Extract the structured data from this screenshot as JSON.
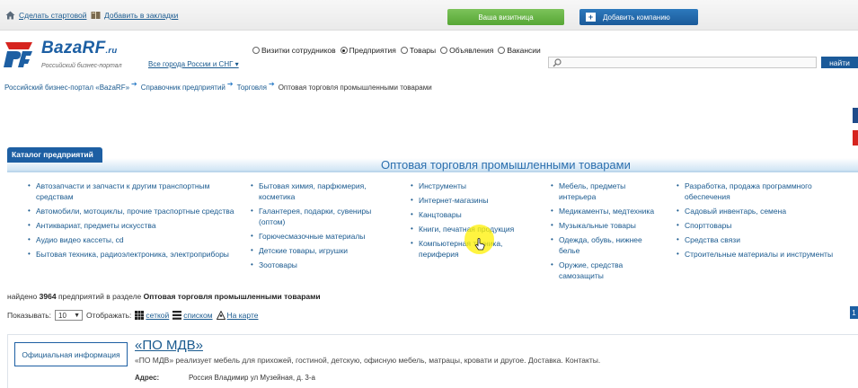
{
  "topbar": {
    "make_start": "Сделать стартовой",
    "bookmark": "Добавить в закладки",
    "card_button": "Ваша визитница",
    "add_button": "Добавить компанию",
    "plus_symbol": "+"
  },
  "logo": {
    "name": "BazaRF",
    "suffix": ".ru",
    "tagline": "Российский бизнес-портал"
  },
  "region": "Все города России и СНГ ▾",
  "search_types": [
    {
      "label": "Визитки сотрудников",
      "checked": false
    },
    {
      "label": "Предприятия",
      "checked": true
    },
    {
      "label": "Товары",
      "checked": false
    },
    {
      "label": "Объявления",
      "checked": false
    },
    {
      "label": "Вакансии",
      "checked": false
    }
  ],
  "search": {
    "value": "",
    "button": "найти"
  },
  "breadcrumb": {
    "items": [
      "Российский бизнес-портал «BazaRF»",
      "Справочник предприятий",
      "Торговля"
    ],
    "current": "Оптовая торговля промышленными товарами"
  },
  "catalog": {
    "tab": "Каталог предприятий",
    "title": "Оптовая торговля промышленными товарами",
    "col1": [
      "Автозапчасти и запчасти к другим транспортным средствам",
      "Автомобили, мотоциклы, прочие траспортные средства",
      "Антиквариат, предметы искусства",
      "Аудио видео кассеты, cd",
      "Бытовая техника, радиоэлектроника, электроприборы"
    ],
    "col2": [
      "Бытовая химия, парфюмерия, косметика",
      "Галантерея, подарки, сувениры (оптом)",
      "Горючесмазочные материалы",
      "Детские товары, игрушки",
      "Зоотовары"
    ],
    "col3": [
      "Инструменты",
      "Интернет-магазины",
      "Канцтовары",
      "Книги, печатная продукция",
      "Компьютерная техника, периферия"
    ],
    "col4": [
      "Мебель, предметы интерьера",
      "Медикаменты, медтехника",
      "Музыкальные товары",
      "Одежда, обувь, нижнее белье",
      "Оружие, средства самозащиты"
    ],
    "col5": [
      "Разработка, продажа программного обеспечения",
      "Садовый инвентарь, семена",
      "Спорттовары",
      "Средства связи",
      "Строительные материалы и инструменты"
    ]
  },
  "results": {
    "found_prefix": "найдено",
    "found_count": "3964",
    "found_mid": "предприятий в разделе",
    "found_section": "Оптовая торговля промышленными товарами",
    "show_label": "Показывать:",
    "show_value": "10",
    "display_label": "Отображать:",
    "view_grid": "сеткой",
    "view_list": "списком",
    "view_map": "На карте",
    "page": "1"
  },
  "company": {
    "official_button": "Официальная информация",
    "name": "«ПО МДВ»",
    "description": "«ПО МДВ» реализует мебель для прихожей, гостиной, детскую, офисную мебель, матрацы, кровати и другое. Доставка. Контакты.",
    "address_label": "Адрес:",
    "address": "Россия Владимир ул Музейная, д. 3-а"
  },
  "colors": {
    "brand_blue": "#1d5fa3",
    "link": "#1a5a8f",
    "green_button": "#56a635",
    "red_accent": "#d6241f"
  }
}
